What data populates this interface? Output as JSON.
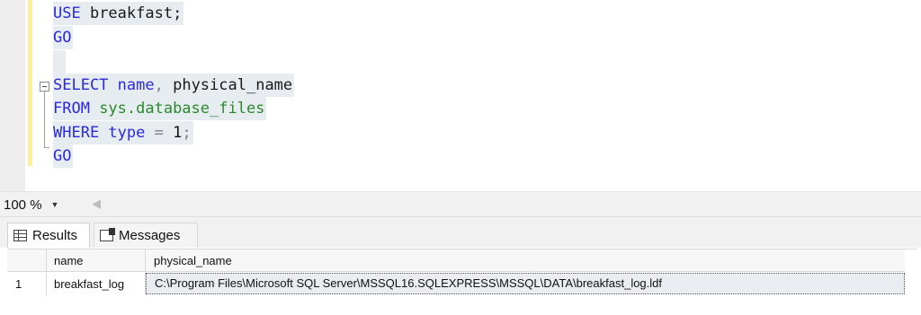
{
  "editor": {
    "lines": {
      "l1": {
        "kw": "USE",
        "rest": " breakfast;"
      },
      "l2": {
        "kw": "GO"
      },
      "l4": {
        "kw": "SELECT",
        "a": " name",
        "comma": ",",
        "b": " physical_name"
      },
      "l5": {
        "kw": "FROM",
        "sys": " sys.database_files"
      },
      "l6": {
        "kw": "WHERE",
        "col": " type",
        "eq": " =",
        "num": " 1",
        "semi": ";"
      },
      "l7": {
        "kw": "GO"
      }
    }
  },
  "zoom": {
    "value": "100 %"
  },
  "tabs": [
    {
      "label": "Results",
      "icon": "grid-icon"
    },
    {
      "label": "Messages",
      "icon": "messages-icon"
    }
  ],
  "results": {
    "columns": [
      "",
      "name",
      "physical_name"
    ],
    "rows": [
      [
        "1",
        "breakfast_log",
        "C:\\Program Files\\Microsoft SQL Server\\MSSQL16.SQLEXPRESS\\MSSQL\\DATA\\breakfast_log.ldf"
      ]
    ]
  },
  "colors": {
    "keyword": "#2a2adc",
    "system_object": "#2a8a2a",
    "change_bar": "#fcee9c"
  }
}
